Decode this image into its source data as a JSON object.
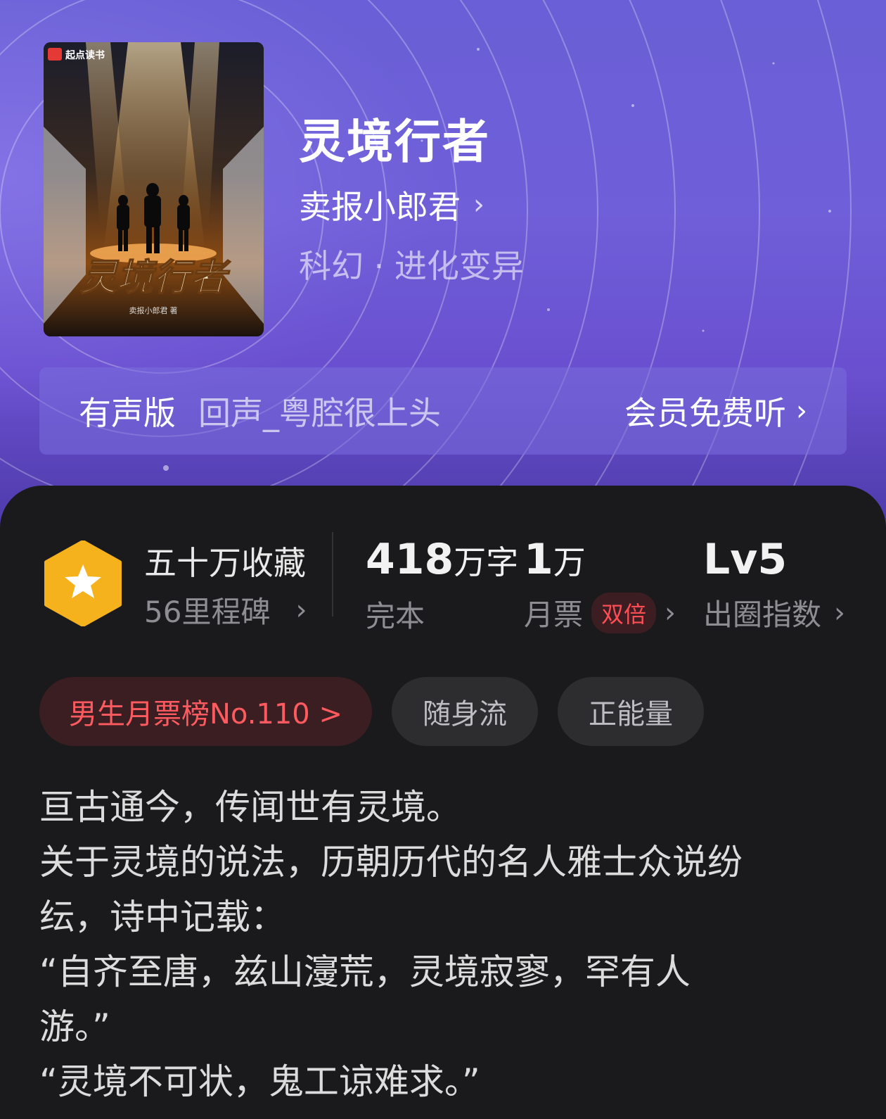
{
  "book": {
    "title": "灵境行者",
    "author": "卖报小郎君",
    "genre": "科幻 · 进化变异",
    "cover_publisher": "起点读书",
    "cover_title": "灵境行者",
    "cover_author": "卖报小郎君 著"
  },
  "audio": {
    "label": "有声版",
    "narrator": "回声_粤腔很上头",
    "cta": "会员免费听"
  },
  "stats": {
    "favorites": "五十万收藏",
    "milestones": "56里程碑",
    "word_count": "418",
    "word_unit": "万字",
    "status": "完本",
    "monthly_tickets": "1",
    "tickets_unit": "万",
    "tickets_label": "月票",
    "double_badge": "双倍",
    "level": "Lv5",
    "level_label": "出圈指数"
  },
  "tags": [
    "男生月票榜No.110 >",
    "随身流",
    "正能量"
  ],
  "description": [
    "亘古通今，传闻世有灵境。",
    "关于灵境的说法，历朝历代的名人雅士众说纷",
    "纭，诗中记载：",
    "“自齐至唐，兹山濅荒，灵境寂寥，罕有人",
    "游。”",
    "“灵境不可状，鬼工谅难求。”"
  ],
  "colors": {
    "hero_purple": "#6a5fd6",
    "panel_bg": "#1a1a1c",
    "rank_red": "#ff5a5f",
    "badge_gold": "#f6b21c"
  },
  "icons": {
    "chevron": "chevron-right-icon",
    "badge": "star-hexagon-icon"
  }
}
